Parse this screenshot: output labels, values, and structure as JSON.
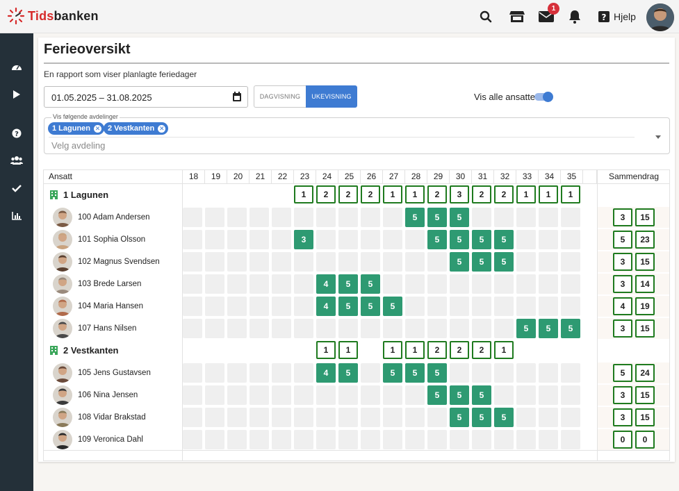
{
  "topbar": {
    "logo_part1": "Tids",
    "logo_part2": "banken",
    "mail_badge": "1",
    "help_label": "Hjelp",
    "icons": [
      "search-icon",
      "store-icon",
      "mail-icon",
      "bell-icon",
      "help-icon"
    ]
  },
  "sidebar": {
    "icons": [
      "dashboard-icon",
      "play-icon",
      "help-icon",
      "users-icon",
      "check-icon",
      "chart-icon"
    ]
  },
  "page": {
    "title": "Ferieoversikt",
    "subtitle": "En rapport som viser planlagte feriedager",
    "date_range": "01.05.2025 – 31.08.2025",
    "view_day": "DAGVISNING",
    "view_week": "UKEVISNING",
    "active_view": "UKEVISNING",
    "show_all_label": "Vis alle ansatte",
    "show_all": true
  },
  "departments_filter": {
    "legend": "Vis følgende avdelinger",
    "chips": [
      "1 Lagunen",
      "2 Vestkanten"
    ],
    "placeholder": "Velg avdeling"
  },
  "grid": {
    "col_employee": "Ansatt",
    "col_summary": "Sammendrag",
    "weeks": [
      "18",
      "19",
      "20",
      "21",
      "22",
      "23",
      "24",
      "25",
      "26",
      "27",
      "28",
      "29",
      "30",
      "31",
      "32",
      "33",
      "34",
      "35"
    ],
    "accent": "#2e9a72",
    "total_border": "#1e7a1e",
    "departments": [
      {
        "name": "1 Lagunen",
        "totals": [
          "",
          "",
          "",
          "",
          "",
          "1",
          "2",
          "2",
          "2",
          "1",
          "1",
          "2",
          "3",
          "2",
          "2",
          "1",
          "1",
          "1"
        ],
        "employees": [
          {
            "name": "100 Adam Andersen",
            "days": [
              "",
              "",
              "",
              "",
              "",
              "",
              "",
              "",
              "",
              "",
              "5",
              "5",
              "5",
              "",
              "",
              "",
              "",
              ""
            ],
            "sum1": "3",
            "sum2": "15"
          },
          {
            "name": "101 Sophia Olsson",
            "days": [
              "",
              "",
              "",
              "",
              "",
              "3",
              "",
              "",
              "",
              "",
              "",
              "5",
              "5",
              "5",
              "5",
              "",
              "",
              ""
            ],
            "sum1": "5",
            "sum2": "23"
          },
          {
            "name": "102 Magnus Svendsen",
            "days": [
              "",
              "",
              "",
              "",
              "",
              "",
              "",
              "",
              "",
              "",
              "",
              "",
              "5",
              "5",
              "5",
              "",
              "",
              ""
            ],
            "sum1": "3",
            "sum2": "15"
          },
          {
            "name": "103 Brede Larsen",
            "days": [
              "",
              "",
              "",
              "",
              "",
              "",
              "4",
              "5",
              "5",
              "",
              "",
              "",
              "",
              "",
              "",
              "",
              "",
              ""
            ],
            "sum1": "3",
            "sum2": "14"
          },
          {
            "name": "104 Maria Hansen",
            "days": [
              "",
              "",
              "",
              "",
              "",
              "",
              "4",
              "5",
              "5",
              "5",
              "",
              "",
              "",
              "",
              "",
              "",
              "",
              ""
            ],
            "sum1": "4",
            "sum2": "19"
          },
          {
            "name": "107 Hans Nilsen",
            "days": [
              "",
              "",
              "",
              "",
              "",
              "",
              "",
              "",
              "",
              "",
              "",
              "",
              "",
              "",
              "",
              "5",
              "5",
              "5"
            ],
            "sum1": "3",
            "sum2": "15"
          }
        ]
      },
      {
        "name": "2 Vestkanten",
        "totals": [
          "",
          "",
          "",
          "",
          "",
          "",
          "1",
          "1",
          "",
          "1",
          "1",
          "2",
          "2",
          "2",
          "1",
          "",
          "",
          ""
        ],
        "employees": [
          {
            "name": "105 Jens Gustavsen",
            "days": [
              "",
              "",
              "",
              "",
              "",
              "",
              "4",
              "5",
              "",
              "5",
              "5",
              "5",
              "",
              "",
              "",
              "",
              "",
              ""
            ],
            "sum1": "5",
            "sum2": "24"
          },
          {
            "name": "106 Nina Jensen",
            "days": [
              "",
              "",
              "",
              "",
              "",
              "",
              "",
              "",
              "",
              "",
              "",
              "5",
              "5",
              "5",
              "",
              "",
              "",
              ""
            ],
            "sum1": "3",
            "sum2": "15"
          },
          {
            "name": "108 Vidar Brakstad",
            "days": [
              "",
              "",
              "",
              "",
              "",
              "",
              "",
              "",
              "",
              "",
              "",
              "",
              "5",
              "5",
              "5",
              "",
              "",
              ""
            ],
            "sum1": "3",
            "sum2": "15"
          },
          {
            "name": "109 Veronica Dahl",
            "days": [
              "",
              "",
              "",
              "",
              "",
              "",
              "",
              "",
              "",
              "",
              "",
              "",
              "",
              "",
              "",
              "",
              "",
              ""
            ],
            "sum1": "0",
            "sum2": "0"
          }
        ]
      }
    ]
  }
}
